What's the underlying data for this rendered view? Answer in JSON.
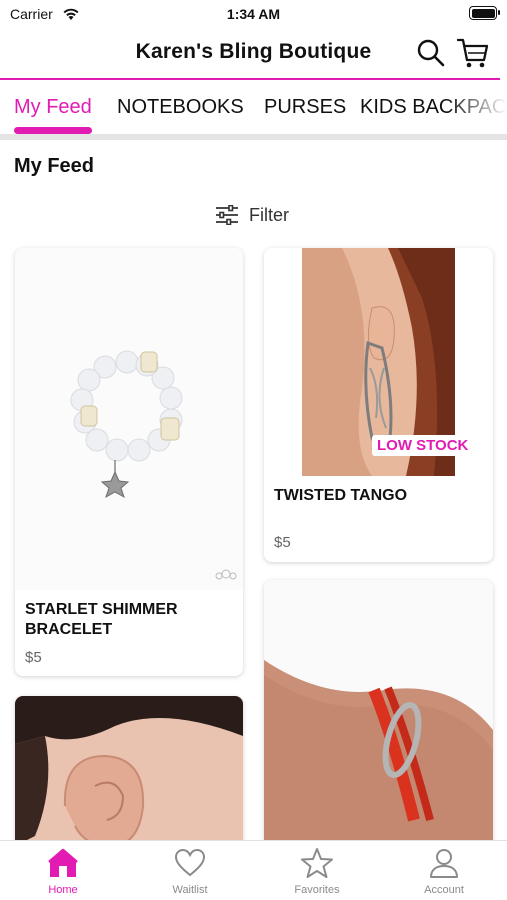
{
  "status_bar": {
    "carrier": "Carrier",
    "time": "1:34 AM"
  },
  "header": {
    "title": "Karen's Bling Boutique"
  },
  "tabs": [
    {
      "label": "My Feed"
    },
    {
      "label": "NOTEBOOKS"
    },
    {
      "label": "PURSES"
    },
    {
      "label": "KIDS BACKPACKS"
    }
  ],
  "feed": {
    "title": "My Feed",
    "filter_label": "Filter",
    "products": [
      {
        "name": "STARLET SHIMMER BRACELET",
        "name_lines": [
          "STARLET SHIMMER",
          "BRACELET"
        ],
        "price": "$5"
      },
      {
        "name": "TWISTED TANGO",
        "price": "$5",
        "badge": "LOW STOCK"
      }
    ]
  },
  "bottom_nav": [
    {
      "label": "Home",
      "icon": "home-icon"
    },
    {
      "label": "Waitlist",
      "icon": "heart-icon"
    },
    {
      "label": "Favorites",
      "icon": "star-icon"
    },
    {
      "label": "Account",
      "icon": "person-icon"
    }
  ],
  "colors": {
    "accent": "#e21bb2",
    "inactive": "#8a8a8a"
  }
}
